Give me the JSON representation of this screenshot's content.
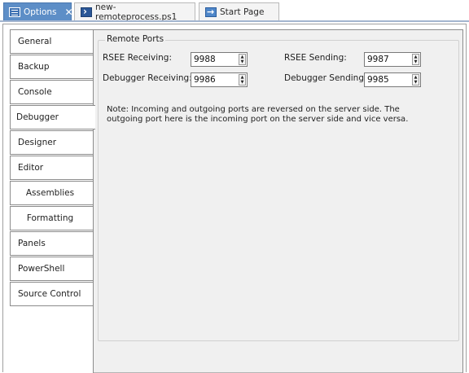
{
  "tabs": [
    {
      "label": "Options",
      "icon": "options-icon",
      "active": true,
      "closable": true
    },
    {
      "label": "new-remoteprocess.ps1",
      "icon": "powershell-file-icon",
      "active": false
    },
    {
      "label": "Start Page",
      "icon": "start-page-icon",
      "active": false
    }
  ],
  "close_glyph": "✕",
  "nav": [
    {
      "label": "General"
    },
    {
      "label": "Backup"
    },
    {
      "label": "Console"
    },
    {
      "label": "Debugger",
      "selected": true
    },
    {
      "label": "Designer"
    },
    {
      "label": "Editor"
    },
    {
      "label": "Assemblies",
      "sub": true
    },
    {
      "label": "Formatting",
      "sub": true
    },
    {
      "label": "Panels"
    },
    {
      "label": "PowerShell"
    },
    {
      "label": "Source Control"
    }
  ],
  "remote_ports": {
    "title": "Remote Ports",
    "rsee_receiving_label": "RSEE Receiving:",
    "rsee_receiving_value": "9988",
    "rsee_sending_label": "RSEE Sending:",
    "rsee_sending_value": "9987",
    "debugger_receiving_label": "Debugger Receiving:",
    "debugger_receiving_value": "9986",
    "debugger_sending_label": "Debugger Sending:",
    "debugger_sending_value": "9985",
    "note": "Note: Incoming and outgoing ports are reversed on the server side. The outgoing port here is the incoming port on the server side and vice versa."
  },
  "colors": {
    "active_tab": "#5d8ec7",
    "panel_background": "#f0f0f0"
  }
}
